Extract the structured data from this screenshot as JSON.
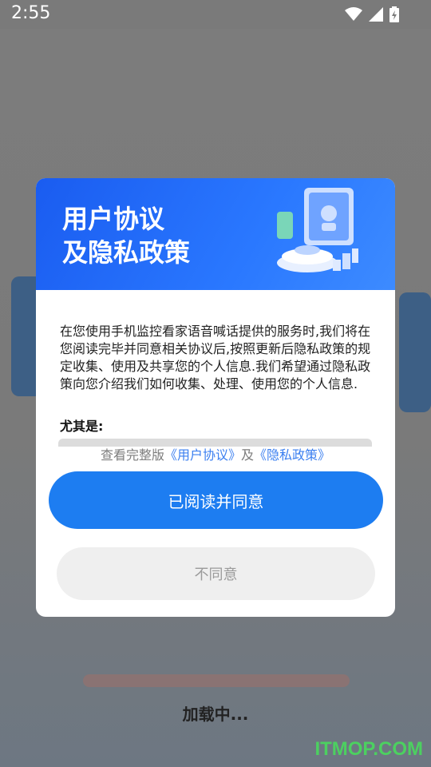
{
  "status_bar": {
    "time": "2:55",
    "icons": [
      "wifi-icon",
      "cell-signal-icon",
      "battery-charging-icon"
    ]
  },
  "background": {
    "loading_text": "加载中..."
  },
  "dialog": {
    "banner_title_line1": "用户协议",
    "banner_title_line2": "及隐私政策",
    "body_text": "在您使用手机监控看家语音喊话提供的服务时,我们将在您阅读完毕并同意相关协议后,按照更新后隐私政策的规定收集、使用及共享您的个人信息.我们希望通过隐私政策向您介绍我们如何收集、处理、使用您的个人信息.",
    "sub_heading": "尤其是:",
    "links": {
      "prefix": "查看完整版",
      "user_agreement": "《用户协议》",
      "connector": "及",
      "privacy_policy": "《隐私政策》"
    },
    "agree_label": "已阅读并同意",
    "disagree_label": "不同意"
  },
  "watermark": "ITMOP.COM",
  "colors": {
    "primary": "#1d7df1",
    "link": "#3b7ff0",
    "banner": "#2a78ff",
    "watermark": "#4cd060"
  }
}
